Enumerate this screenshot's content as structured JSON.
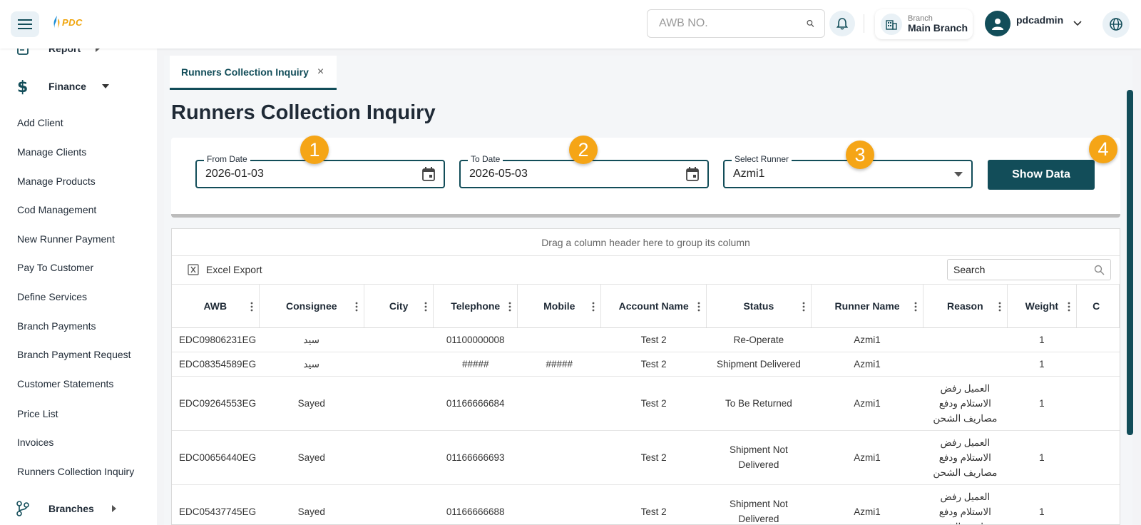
{
  "header": {
    "logo_text": "PDC",
    "awb_placeholder": "AWB NO.",
    "branch_label": "Branch",
    "branch_name": "Main Branch",
    "username": "pdcadmin"
  },
  "sidebar": {
    "report_label": "Report",
    "finance_label": "Finance",
    "items": [
      "Add Client",
      "Manage Clients",
      "Manage Products",
      "Cod Management",
      "New Runner Payment",
      "Pay To Customer",
      "Define Services",
      "Branch Payments",
      "Branch Payment Request",
      "Customer Statements",
      "Price List",
      "Invoices",
      "Runners Collection Inquiry"
    ],
    "branches_label": "Branches"
  },
  "tab": {
    "label": "Runners Collection Inquiry",
    "close": "×"
  },
  "page_title": "Runners Collection Inquiry",
  "filters": {
    "from_label": "From Date",
    "from_value": "2026-01-03",
    "to_label": "To Date",
    "to_value": "2026-05-03",
    "runner_label": "Select Runner",
    "runner_value": "Azmi1",
    "show_button": "Show Data",
    "badges": [
      "1",
      "2",
      "3",
      "4"
    ]
  },
  "grid": {
    "group_hint": "Drag a column header here to group its column",
    "excel_export": "Excel Export",
    "search_placeholder": "Search",
    "columns": [
      "AWB",
      "Consignee",
      "City",
      "Telephone",
      "Mobile",
      "Account Name",
      "Status",
      "Runner Name",
      "Reason",
      "Weight",
      "C"
    ],
    "rows": [
      [
        "EDC09806231EG",
        "سيد",
        "",
        "01100000008",
        "",
        "Test 2",
        "Re-Operate",
        "Azmi1",
        "",
        "1"
      ],
      [
        "EDC08354589EG",
        "سيد",
        "",
        "#####",
        "#####",
        "Test 2",
        "Shipment Delivered",
        "Azmi1",
        "",
        "1"
      ],
      [
        "EDC09264553EG",
        "Sayed",
        "",
        "01166666684",
        "",
        "Test 2",
        "To Be Returned",
        "Azmi1",
        "العميل رفض الاستلام ودفع مصاريف الشحن",
        "1"
      ],
      [
        "EDC00656440EG",
        "Sayed",
        "",
        "01166666693",
        "",
        "Test 2",
        "Shipment Not Delivered",
        "Azmi1",
        "العميل رفض الاستلام ودفع مصاريف الشحن",
        "1"
      ],
      [
        "EDC05437745EG",
        "Sayed",
        "",
        "01166666688",
        "",
        "Test 2",
        "Shipment Not Delivered",
        "Azmi1",
        "العميل رفض الاستلام ودفع مصاريف الشحن",
        "1"
      ]
    ]
  },
  "colors": {
    "primary": "#124d59",
    "accent": "#f5a516",
    "logo": "#f0a40a"
  }
}
